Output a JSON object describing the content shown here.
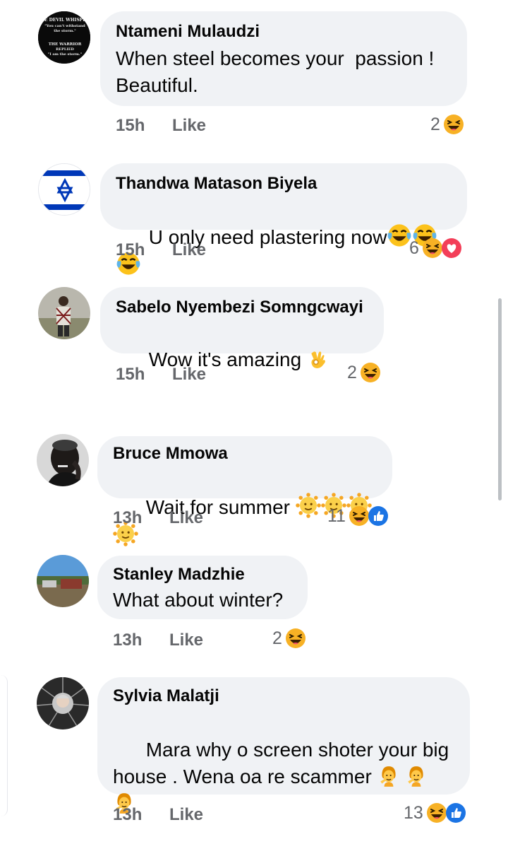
{
  "comments": [
    {
      "name": "Ntameni Mulaudzi",
      "text": "When steel becomes your  passion !\nBeautiful.",
      "time": "15h",
      "like": "Like",
      "reaction_count": "2",
      "reactions": [
        "haha"
      ],
      "avatar_text": [
        "HE DEVIL WHISPER",
        "\"You can't withstand",
        "the storm.\"",
        "THE WARRIOR",
        "REPLIED",
        "\"I am the storm.\""
      ]
    },
    {
      "name": "Thandwa Matason Biyela",
      "text": "U only need plastering now",
      "inline_emoji": [
        "tears-of-joy",
        "tears-of-joy",
        "tears-of-joy"
      ],
      "time": "15h",
      "like": "Like",
      "reaction_count": "6",
      "reactions": [
        "haha",
        "love"
      ]
    },
    {
      "name": "Sabelo Nyembezi Somngcwayi",
      "text": "Wow it's amazing ",
      "inline_emoji": [
        "ok-hand"
      ],
      "time": "15h",
      "like": "Like",
      "reaction_count": "2",
      "reactions": [
        "haha"
      ]
    },
    {
      "name": "Bruce Mmowa",
      "text": "Wait for summer ",
      "inline_emoji": [
        "sun-face",
        "sun-face",
        "sun-face",
        "sun-face"
      ],
      "time": "13h",
      "like": "Like",
      "reaction_count": "11",
      "reactions": [
        "haha",
        "like"
      ]
    },
    {
      "name": "Stanley Madzhie",
      "text": "What about winter?",
      "time": "13h",
      "like": "Like",
      "reaction_count": "2",
      "reactions": [
        "haha"
      ]
    },
    {
      "name": "Sylvia Malatji",
      "text": "Mara why o screen shoter your big\nhouse . Wena oa re scammer ",
      "inline_emoji": [
        "person-facepalming",
        "person-facepalming",
        "person-facepalming"
      ],
      "time": "13h",
      "like": "Like",
      "reaction_count": "13",
      "reactions": [
        "haha",
        "like"
      ]
    }
  ],
  "colors": {
    "bubble": "#f0f2f5",
    "meta_text": "#65676b",
    "haha": "#f7b125",
    "love": "#f33e58",
    "like_blue": "#1b74e4",
    "israel_blue": "#0038b8"
  }
}
